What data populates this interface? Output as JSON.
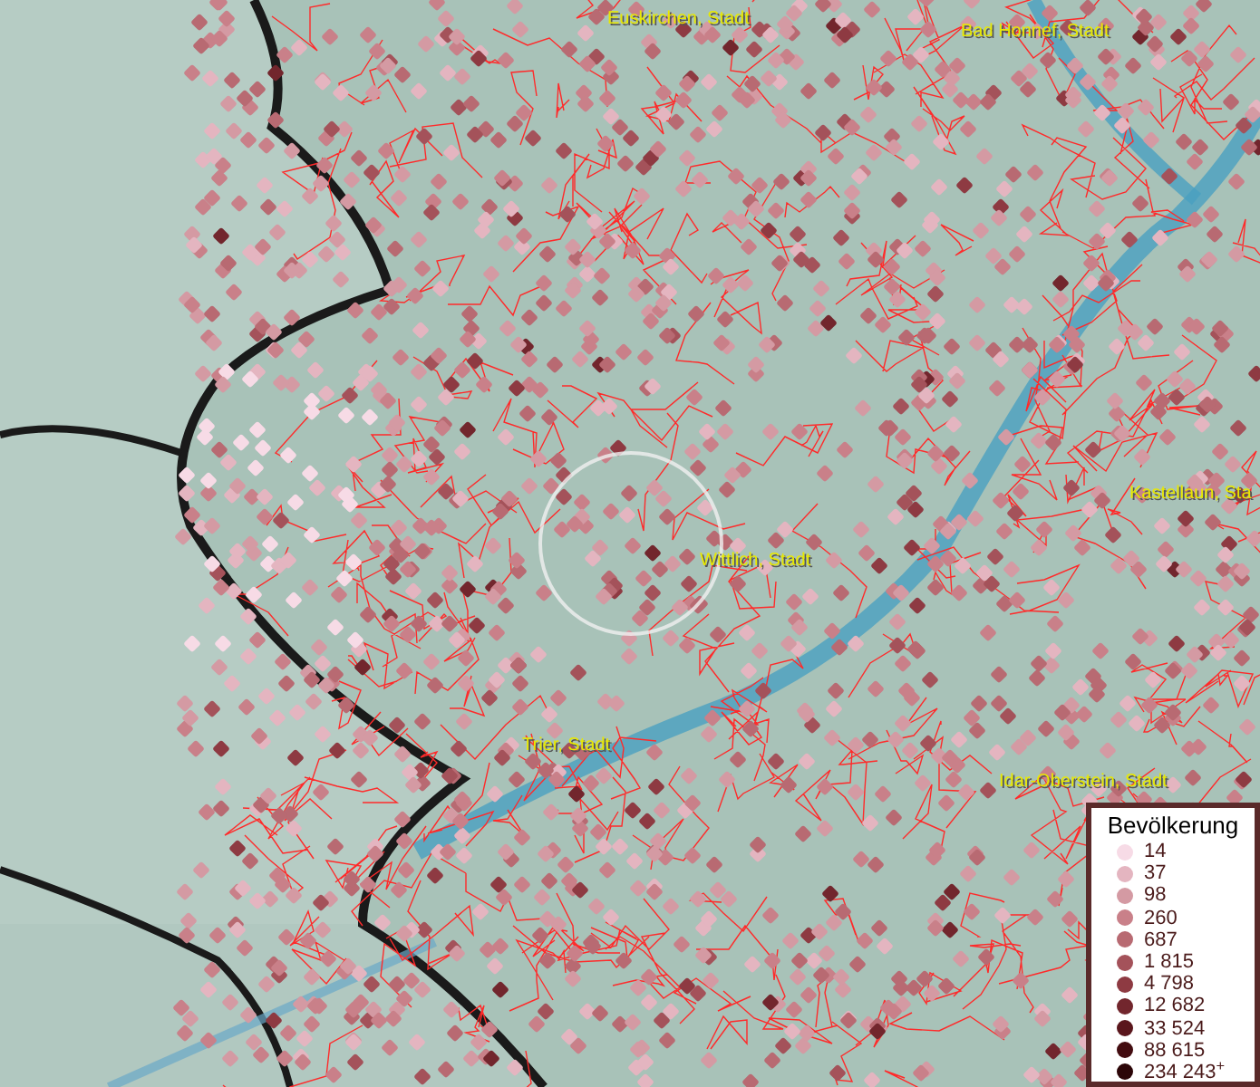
{
  "map": {
    "cities": [
      {
        "name": "Euskirchen, Stadt"
      },
      {
        "name": "Bad Honnef, Stadt"
      },
      {
        "name": "Kastellaun, Sta"
      },
      {
        "name": "Wittlich, Stadt"
      },
      {
        "name": "Trier, Stadt"
      },
      {
        "name": "Idar-Oberstein, Stadt"
      }
    ]
  },
  "legend": {
    "title": "Bevölkerung",
    "items": [
      {
        "label": "14",
        "color": "#f7dbe6"
      },
      {
        "label": "37",
        "color": "#e4b5c0"
      },
      {
        "label": "98",
        "color": "#d49aa3"
      },
      {
        "label": "260",
        "color": "#c98089"
      },
      {
        "label": "687",
        "color": "#b86a72"
      },
      {
        "label": "1 815",
        "color": "#a4525a"
      },
      {
        "label": "4 798",
        "color": "#8e3a42"
      },
      {
        "label": "12 682",
        "color": "#72262d"
      },
      {
        "label": "33 524",
        "color": "#5a161c"
      },
      {
        "label": "88 615",
        "color": "#430c10"
      },
      {
        "label": "234 243$^{+}$",
        "color": "#2c0608"
      }
    ]
  }
}
